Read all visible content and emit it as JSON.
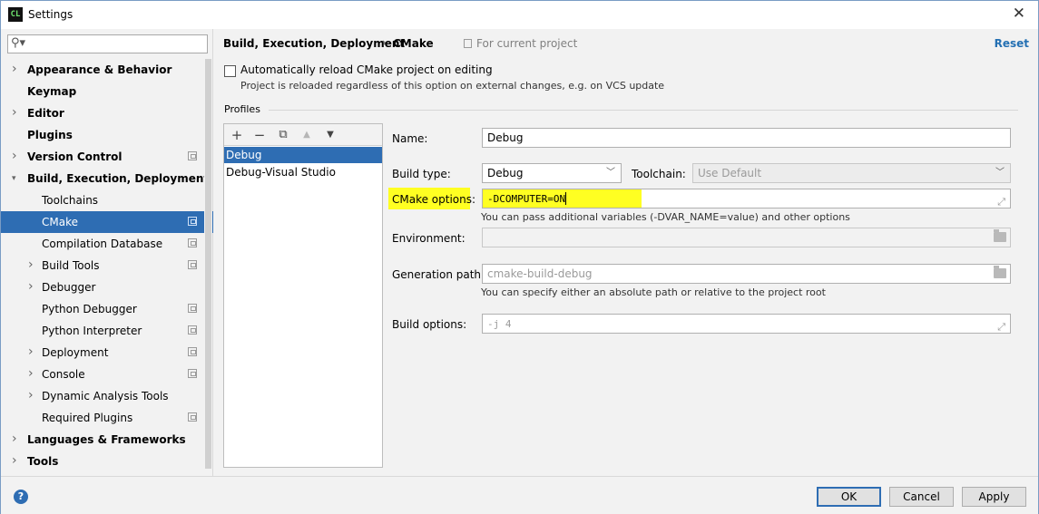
{
  "window": {
    "title": "Settings",
    "app_icon": "CL",
    "close_glyph": "✕"
  },
  "search": {
    "placeholder": "",
    "icon": "search-icon"
  },
  "tree": [
    {
      "label": "Appearance & Behavior",
      "expandable": true,
      "bold": true,
      "indent": 0
    },
    {
      "label": "Keymap",
      "expandable": false,
      "bold": true,
      "indent": 0
    },
    {
      "label": "Editor",
      "expandable": true,
      "bold": true,
      "indent": 0
    },
    {
      "label": "Plugins",
      "expandable": false,
      "bold": true,
      "indent": 0
    },
    {
      "label": "Version Control",
      "expandable": true,
      "bold": true,
      "indent": 0,
      "project": true
    },
    {
      "label": "Build, Execution, Deployment",
      "expandable": true,
      "expanded": true,
      "bold": true,
      "indent": 0
    },
    {
      "label": "Toolchains",
      "expandable": false,
      "bold": false,
      "indent": 1
    },
    {
      "label": "CMake",
      "expandable": false,
      "bold": false,
      "indent": 1,
      "project": true,
      "selected": true
    },
    {
      "label": "Compilation Database",
      "expandable": false,
      "bold": false,
      "indent": 1,
      "project": true
    },
    {
      "label": "Build Tools",
      "expandable": true,
      "bold": false,
      "indent": 1,
      "project": true
    },
    {
      "label": "Debugger",
      "expandable": true,
      "bold": false,
      "indent": 1
    },
    {
      "label": "Python Debugger",
      "expandable": false,
      "bold": false,
      "indent": 1,
      "project": true
    },
    {
      "label": "Python Interpreter",
      "expandable": false,
      "bold": false,
      "indent": 1,
      "project": true
    },
    {
      "label": "Deployment",
      "expandable": true,
      "bold": false,
      "indent": 1,
      "project": true
    },
    {
      "label": "Console",
      "expandable": true,
      "bold": false,
      "indent": 1,
      "project": true
    },
    {
      "label": "Dynamic Analysis Tools",
      "expandable": true,
      "bold": false,
      "indent": 1
    },
    {
      "label": "Required Plugins",
      "expandable": false,
      "bold": false,
      "indent": 1,
      "project": true
    },
    {
      "label": "Languages & Frameworks",
      "expandable": true,
      "bold": true,
      "indent": 0
    },
    {
      "label": "Tools",
      "expandable": true,
      "bold": true,
      "indent": 0
    }
  ],
  "header": {
    "crumb1": "Build, Execution, Deployment",
    "separator": "›",
    "crumb2": "CMake",
    "for_project": "For current project",
    "reset": "Reset"
  },
  "reload": {
    "checked": false,
    "label": "Automatically reload CMake project on editing",
    "hint": "Project is reloaded regardless of this option on external changes, e.g. on VCS update"
  },
  "profiles": {
    "section_label": "Profiles",
    "toolbar": {
      "add": "+",
      "remove": "−",
      "copy": "⧉",
      "up": "▲",
      "down": "▼"
    },
    "items": [
      {
        "label": "Debug",
        "selected": true
      },
      {
        "label": "Debug-Visual Studio",
        "selected": false
      }
    ]
  },
  "form": {
    "name_label": "Name:",
    "name_value": "Debug",
    "build_type_label": "Build type:",
    "build_type_value": "Debug",
    "toolchain_label": "Toolchain:",
    "toolchain_value": "Use Default",
    "cmake_options_label": "CMake options:",
    "cmake_options_value": "-DCOMPUTER=ON",
    "cmake_options_hint": "You can pass additional variables (-DVAR_NAME=value) and other options",
    "environment_label": "Environment:",
    "environment_value": "",
    "generation_path_label": "Generation path:",
    "generation_path_placeholder": "cmake-build-debug",
    "generation_path_hint": "You can specify either an absolute path or relative to the project root",
    "build_options_label": "Build options:",
    "build_options_placeholder": "-j 4",
    "highlight_color": "#ffff22"
  },
  "footer": {
    "help": "?",
    "ok": "OK",
    "cancel": "Cancel",
    "apply": "Apply"
  },
  "colors": {
    "selection": "#2e6db3",
    "link": "#2470b3"
  }
}
